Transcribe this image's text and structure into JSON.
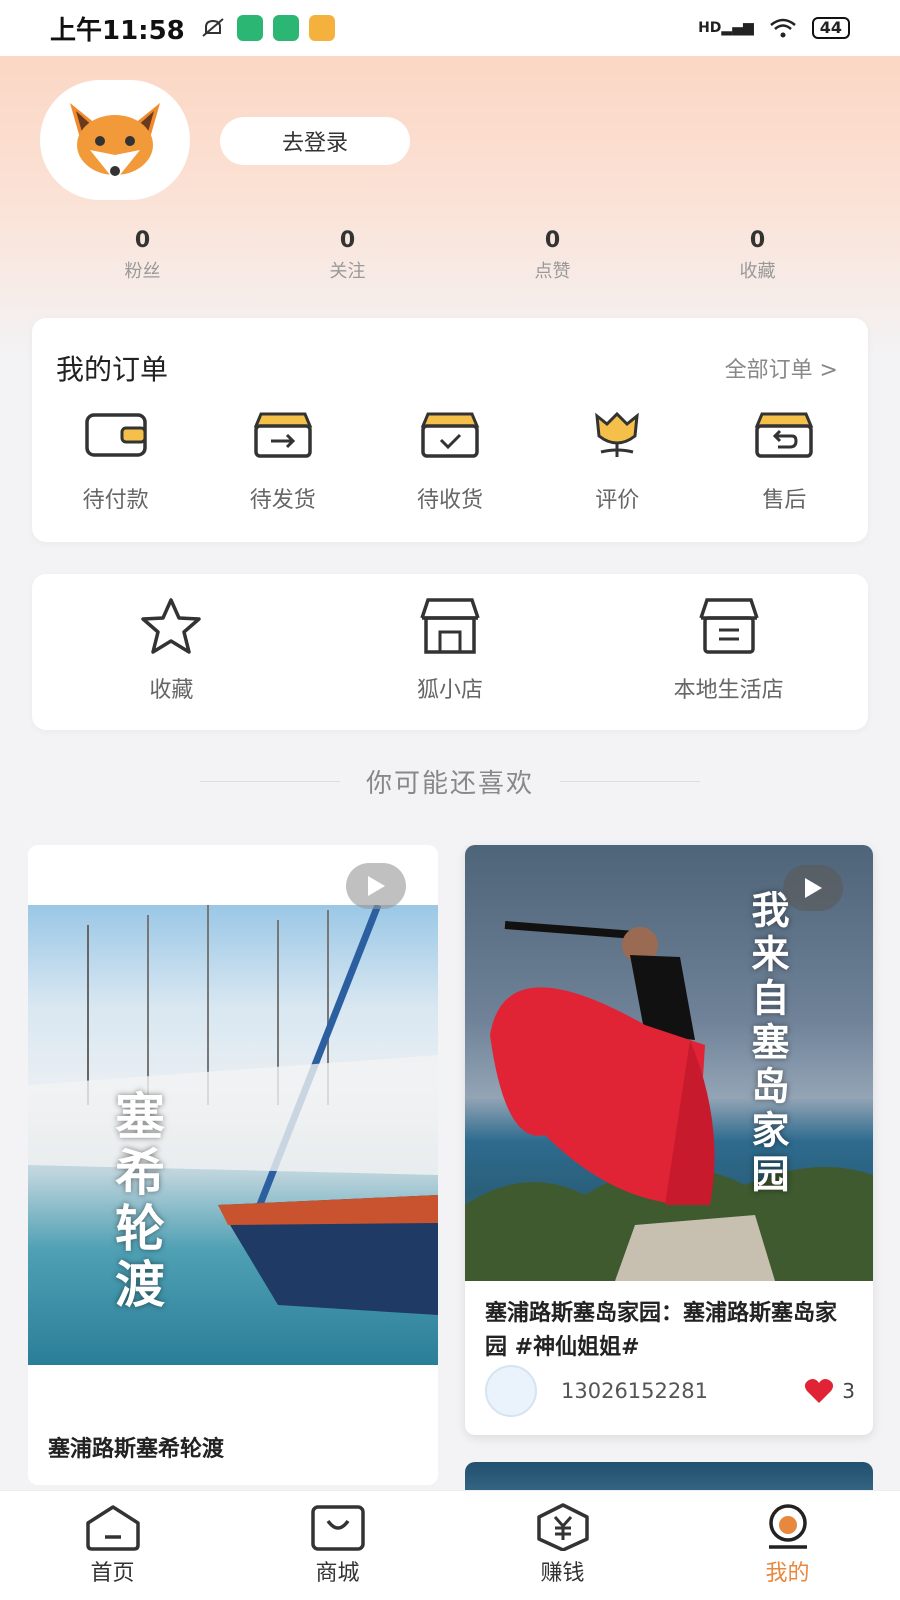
{
  "status_bar": {
    "time": "上午11:58",
    "battery": "44",
    "signal": "HD"
  },
  "profile": {
    "login_label": "去登录"
  },
  "stats": [
    {
      "value": "0",
      "label": "粉丝"
    },
    {
      "value": "0",
      "label": "关注"
    },
    {
      "value": "0",
      "label": "点赞"
    },
    {
      "value": "0",
      "label": "收藏"
    }
  ],
  "orders": {
    "title": "我的订单",
    "all_label": "全部订单 >",
    "items": [
      {
        "label": "待付款",
        "icon": "wallet-icon"
      },
      {
        "label": "待发货",
        "icon": "box-arrow-icon"
      },
      {
        "label": "待收货",
        "icon": "box-check-icon"
      },
      {
        "label": "评价",
        "icon": "tulip-icon"
      },
      {
        "label": "售后",
        "icon": "box-return-icon"
      }
    ]
  },
  "shortcuts": [
    {
      "label": "收藏",
      "icon": "star-icon"
    },
    {
      "label": "狐小店",
      "icon": "shop-icon"
    },
    {
      "label": "本地生活店",
      "icon": "store-icon"
    }
  ],
  "recommend": {
    "title": "你可能还喜欢"
  },
  "feed": [
    {
      "overlay": "塞希轮渡",
      "title": "塞浦路斯塞希轮渡"
    },
    {
      "overlay": "我来自塞岛家园",
      "title": "塞浦路斯塞岛家园：塞浦路斯塞岛家园 #神仙姐姐#",
      "author": "13026152281",
      "likes": "3"
    }
  ],
  "tabbar": [
    {
      "label": "首页",
      "icon": "home-icon"
    },
    {
      "label": "商城",
      "icon": "bag-icon"
    },
    {
      "label": "赚钱",
      "icon": "coin-icon"
    },
    {
      "label": "我的",
      "icon": "profile-icon",
      "active": true
    }
  ],
  "colors": {
    "accent": "#e8873e",
    "yellow": "#f5c04a",
    "header": "#fbd2bd"
  }
}
